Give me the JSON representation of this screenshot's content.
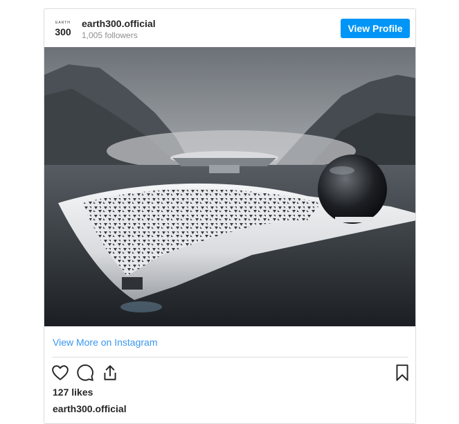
{
  "header": {
    "logo_text": "EARTH 300",
    "username": "earth300.official",
    "followers": "1,005 followers",
    "view_profile_label": "View Profile"
  },
  "post": {
    "image_subject": "futuristic white ship with perforated hull and glass sphere on a fjord",
    "view_more_label": "View More on Instagram",
    "likes": "127 likes",
    "caption_username": "earth300.official"
  },
  "actions": {
    "icons": [
      "heart-icon",
      "comment-icon",
      "share-icon",
      "bookmark-icon"
    ]
  },
  "colors": {
    "accent": "#0095f6",
    "link": "#3897f0",
    "border": "#dbdbdb",
    "muted": "#8e8e8e"
  }
}
